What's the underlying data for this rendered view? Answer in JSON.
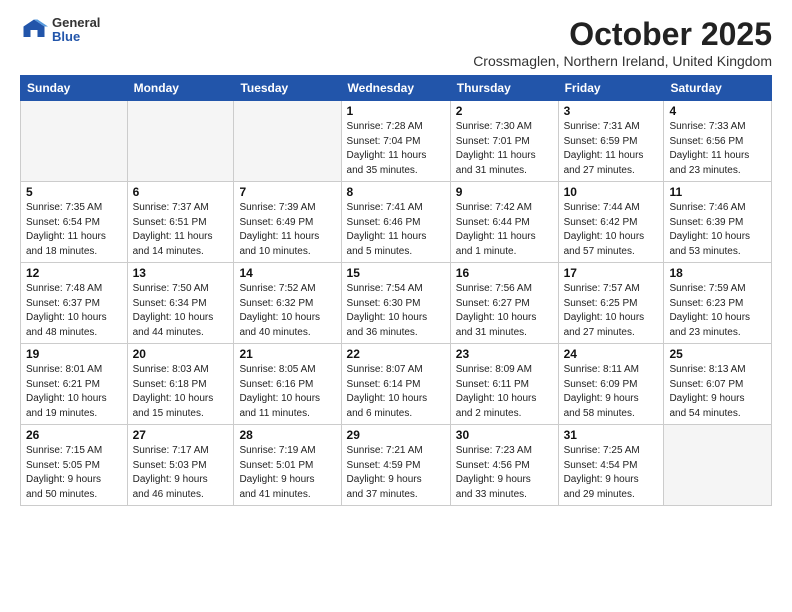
{
  "header": {
    "logo_line1": "General",
    "logo_line2": "Blue",
    "month": "October 2025",
    "location": "Crossmaglen, Northern Ireland, United Kingdom"
  },
  "weekdays": [
    "Sunday",
    "Monday",
    "Tuesday",
    "Wednesday",
    "Thursday",
    "Friday",
    "Saturday"
  ],
  "weeks": [
    [
      {
        "day": "",
        "info": ""
      },
      {
        "day": "",
        "info": ""
      },
      {
        "day": "",
        "info": ""
      },
      {
        "day": "1",
        "info": "Sunrise: 7:28 AM\nSunset: 7:04 PM\nDaylight: 11 hours\nand 35 minutes."
      },
      {
        "day": "2",
        "info": "Sunrise: 7:30 AM\nSunset: 7:01 PM\nDaylight: 11 hours\nand 31 minutes."
      },
      {
        "day": "3",
        "info": "Sunrise: 7:31 AM\nSunset: 6:59 PM\nDaylight: 11 hours\nand 27 minutes."
      },
      {
        "day": "4",
        "info": "Sunrise: 7:33 AM\nSunset: 6:56 PM\nDaylight: 11 hours\nand 23 minutes."
      }
    ],
    [
      {
        "day": "5",
        "info": "Sunrise: 7:35 AM\nSunset: 6:54 PM\nDaylight: 11 hours\nand 18 minutes."
      },
      {
        "day": "6",
        "info": "Sunrise: 7:37 AM\nSunset: 6:51 PM\nDaylight: 11 hours\nand 14 minutes."
      },
      {
        "day": "7",
        "info": "Sunrise: 7:39 AM\nSunset: 6:49 PM\nDaylight: 11 hours\nand 10 minutes."
      },
      {
        "day": "8",
        "info": "Sunrise: 7:41 AM\nSunset: 6:46 PM\nDaylight: 11 hours\nand 5 minutes."
      },
      {
        "day": "9",
        "info": "Sunrise: 7:42 AM\nSunset: 6:44 PM\nDaylight: 11 hours\nand 1 minute."
      },
      {
        "day": "10",
        "info": "Sunrise: 7:44 AM\nSunset: 6:42 PM\nDaylight: 10 hours\nand 57 minutes."
      },
      {
        "day": "11",
        "info": "Sunrise: 7:46 AM\nSunset: 6:39 PM\nDaylight: 10 hours\nand 53 minutes."
      }
    ],
    [
      {
        "day": "12",
        "info": "Sunrise: 7:48 AM\nSunset: 6:37 PM\nDaylight: 10 hours\nand 48 minutes."
      },
      {
        "day": "13",
        "info": "Sunrise: 7:50 AM\nSunset: 6:34 PM\nDaylight: 10 hours\nand 44 minutes."
      },
      {
        "day": "14",
        "info": "Sunrise: 7:52 AM\nSunset: 6:32 PM\nDaylight: 10 hours\nand 40 minutes."
      },
      {
        "day": "15",
        "info": "Sunrise: 7:54 AM\nSunset: 6:30 PM\nDaylight: 10 hours\nand 36 minutes."
      },
      {
        "day": "16",
        "info": "Sunrise: 7:56 AM\nSunset: 6:27 PM\nDaylight: 10 hours\nand 31 minutes."
      },
      {
        "day": "17",
        "info": "Sunrise: 7:57 AM\nSunset: 6:25 PM\nDaylight: 10 hours\nand 27 minutes."
      },
      {
        "day": "18",
        "info": "Sunrise: 7:59 AM\nSunset: 6:23 PM\nDaylight: 10 hours\nand 23 minutes."
      }
    ],
    [
      {
        "day": "19",
        "info": "Sunrise: 8:01 AM\nSunset: 6:21 PM\nDaylight: 10 hours\nand 19 minutes."
      },
      {
        "day": "20",
        "info": "Sunrise: 8:03 AM\nSunset: 6:18 PM\nDaylight: 10 hours\nand 15 minutes."
      },
      {
        "day": "21",
        "info": "Sunrise: 8:05 AM\nSunset: 6:16 PM\nDaylight: 10 hours\nand 11 minutes."
      },
      {
        "day": "22",
        "info": "Sunrise: 8:07 AM\nSunset: 6:14 PM\nDaylight: 10 hours\nand 6 minutes."
      },
      {
        "day": "23",
        "info": "Sunrise: 8:09 AM\nSunset: 6:11 PM\nDaylight: 10 hours\nand 2 minutes."
      },
      {
        "day": "24",
        "info": "Sunrise: 8:11 AM\nSunset: 6:09 PM\nDaylight: 9 hours\nand 58 minutes."
      },
      {
        "day": "25",
        "info": "Sunrise: 8:13 AM\nSunset: 6:07 PM\nDaylight: 9 hours\nand 54 minutes."
      }
    ],
    [
      {
        "day": "26",
        "info": "Sunrise: 7:15 AM\nSunset: 5:05 PM\nDaylight: 9 hours\nand 50 minutes."
      },
      {
        "day": "27",
        "info": "Sunrise: 7:17 AM\nSunset: 5:03 PM\nDaylight: 9 hours\nand 46 minutes."
      },
      {
        "day": "28",
        "info": "Sunrise: 7:19 AM\nSunset: 5:01 PM\nDaylight: 9 hours\nand 41 minutes."
      },
      {
        "day": "29",
        "info": "Sunrise: 7:21 AM\nSunset: 4:59 PM\nDaylight: 9 hours\nand 37 minutes."
      },
      {
        "day": "30",
        "info": "Sunrise: 7:23 AM\nSunset: 4:56 PM\nDaylight: 9 hours\nand 33 minutes."
      },
      {
        "day": "31",
        "info": "Sunrise: 7:25 AM\nSunset: 4:54 PM\nDaylight: 9 hours\nand 29 minutes."
      },
      {
        "day": "",
        "info": ""
      }
    ]
  ]
}
